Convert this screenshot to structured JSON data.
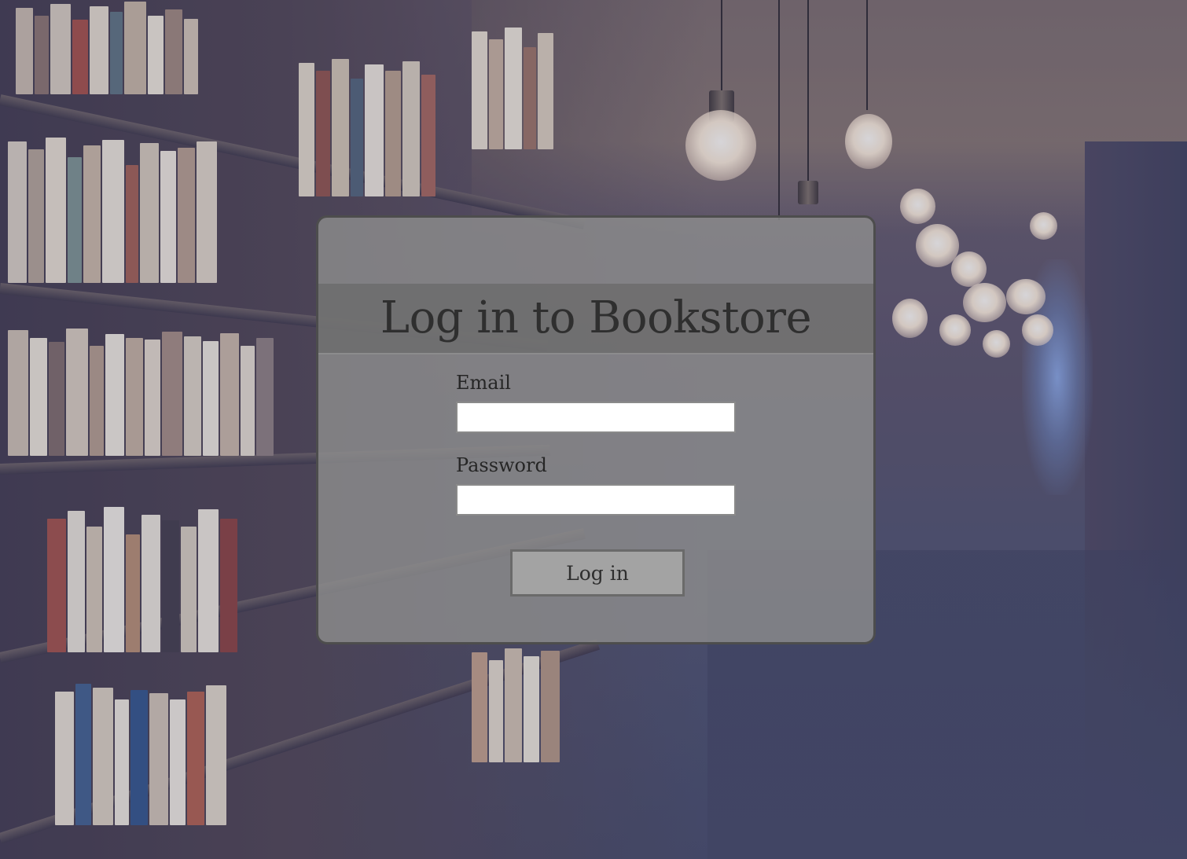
{
  "login_panel": {
    "title": "Log in to Bookstore",
    "email_label": "Email",
    "email_value": "",
    "password_label": "Password",
    "password_value": "",
    "submit_label": "Log in"
  },
  "colors": {
    "panel_background": "#8c8c8c",
    "panel_border": "#4d4d4d",
    "header_band": "#696969",
    "button_background": "#a3a3a3",
    "text": "#2f2f2f"
  }
}
